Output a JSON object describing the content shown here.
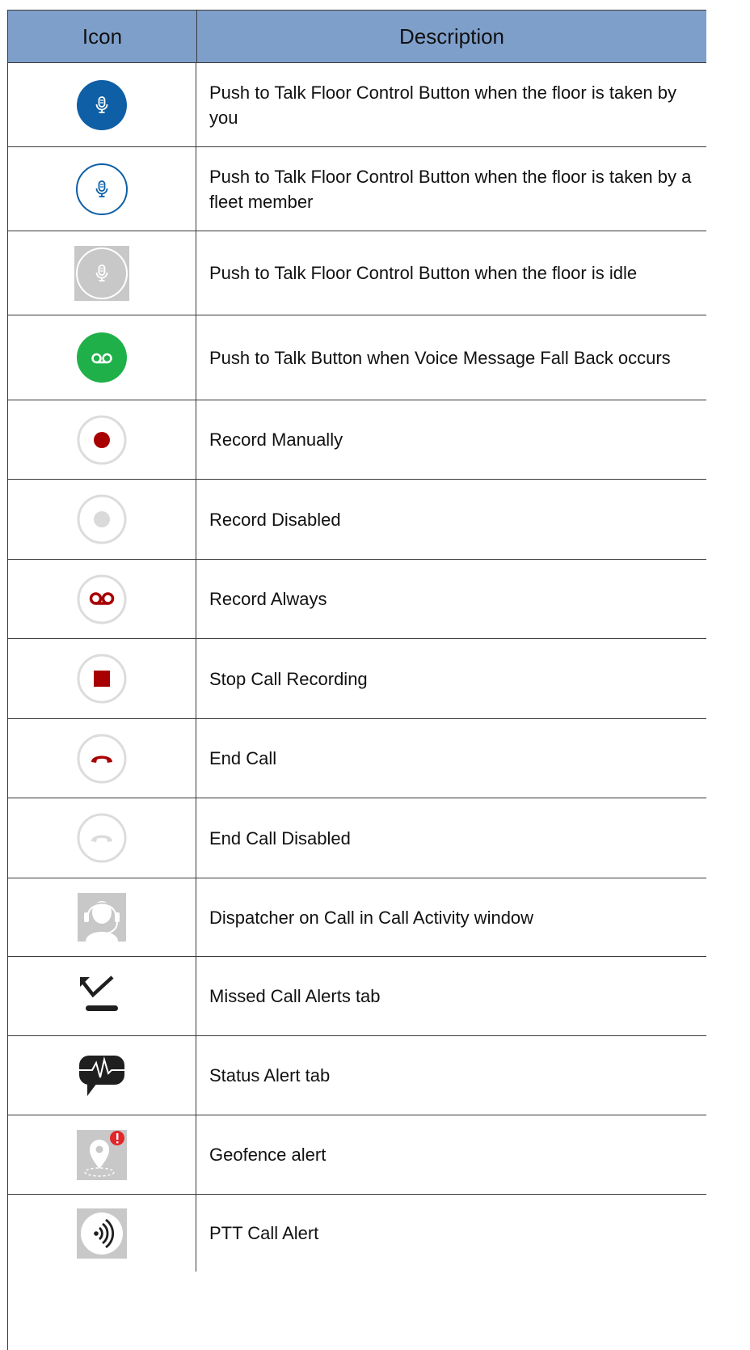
{
  "table": {
    "headers": {
      "icon": "Icon",
      "description": "Description"
    },
    "rows": [
      {
        "icon": "ptt-floor-taken-by-you-icon",
        "description": "Push to Talk Floor Control Button when the floor is taken by you"
      },
      {
        "icon": "ptt-floor-taken-by-fleet-member-icon",
        "description": "Push to Talk Floor Control Button when the floor is taken by a fleet member"
      },
      {
        "icon": "ptt-floor-idle-icon",
        "description": "Push to Talk Floor Control Button when the floor is idle"
      },
      {
        "icon": "voice-message-fallback-icon",
        "description": "Push to Talk Button when Voice Message Fall Back occurs"
      },
      {
        "icon": "record-manually-icon",
        "description": "Record Manually"
      },
      {
        "icon": "record-disabled-icon",
        "description": "Record Disabled"
      },
      {
        "icon": "record-always-icon",
        "description": "Record Always"
      },
      {
        "icon": "stop-call-recording-icon",
        "description": "Stop Call Recording"
      },
      {
        "icon": "end-call-icon",
        "description": "End Call"
      },
      {
        "icon": "end-call-disabled-icon",
        "description": "End Call Disabled"
      },
      {
        "icon": "dispatcher-headset-icon",
        "description": "Dispatcher on Call in Call Activity window"
      },
      {
        "icon": "missed-call-alerts-icon",
        "description": "Missed Call Alerts tab"
      },
      {
        "icon": "status-alert-icon",
        "description": "Status Alert tab"
      },
      {
        "icon": "geofence-alert-icon",
        "description": "Geofence alert"
      },
      {
        "icon": "ptt-call-alert-icon",
        "description": "PTT Call Alert"
      }
    ]
  },
  "colors": {
    "header_bg": "#7f9fcb",
    "ptt_blue": "#0e5fa6",
    "voice_green": "#1fb04a",
    "record_red": "#a80000",
    "disabled_gray": "#c8c8c8",
    "alert_red": "#e3262a"
  }
}
